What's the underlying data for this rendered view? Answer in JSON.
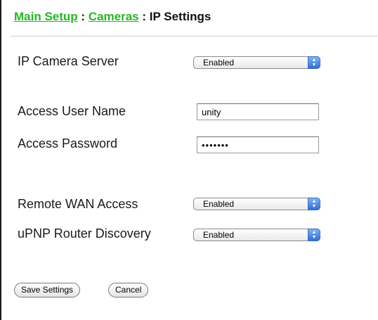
{
  "breadcrumb": {
    "main_setup": "Main Setup",
    "separator_1": ":",
    "cameras": "Cameras",
    "separator_2": ":",
    "current": "IP Settings"
  },
  "form": {
    "ip_camera_server": {
      "label": "IP Camera Server",
      "value": "Enabled"
    },
    "access_user_name": {
      "label": "Access User Name",
      "value": "unity"
    },
    "access_password": {
      "label": "Access Password",
      "value": "•••••••"
    },
    "remote_wan_access": {
      "label": "Remote WAN Access",
      "value": "Enabled"
    },
    "upnp_router_discovery": {
      "label": "uPNP Router Discovery",
      "value": "Enabled"
    }
  },
  "buttons": {
    "save": "Save Settings",
    "cancel": "Cancel"
  },
  "colors": {
    "link_green": "#22b822",
    "select_arrow_blue": "#2f6fd6"
  }
}
